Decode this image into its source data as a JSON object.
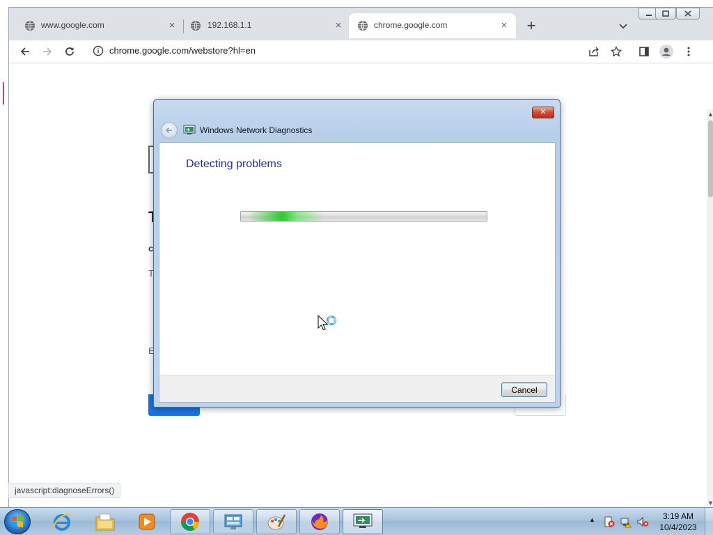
{
  "browser": {
    "tabs": [
      {
        "title": "www.google.com",
        "active": false
      },
      {
        "title": "192.168.1.1",
        "active": false
      },
      {
        "title": "chrome.google.com",
        "active": true
      }
    ],
    "tab_close_glyph": "×",
    "new_tab_glyph": "+",
    "url": "chrome.google.com/webstore?hl=en",
    "status_text": "javascript:diagnoseErrors()"
  },
  "page_fragments": {
    "heading_initial": "T",
    "sub_initial": "c",
    "text_initial": "T",
    "text2_initial": "E"
  },
  "dialog": {
    "title": "Windows Network Diagnostics",
    "heading": "Detecting problems",
    "close_glyph": "✕",
    "cancel_label": "Cancel",
    "progress": {
      "mode": "indeterminate",
      "glow_color": "#2ec82e"
    }
  },
  "taskbar": {
    "pinned": [
      "internet-explorer-icon",
      "file-explorer-icon",
      "media-player-icon",
      "chrome-icon",
      "control-panel-icon",
      "paint-icon",
      "firefox-icon",
      "network-diagnostics-icon"
    ],
    "tray_icons": [
      "action-center-icon",
      "network-error-icon",
      "volume-muted-icon"
    ],
    "clock_time": "3:19 AM",
    "clock_date": "10/4/2023"
  },
  "colors": {
    "chrome_tabstrip": "#dee1e6",
    "dialog_frame": "#bed4ec",
    "dialog_heading": "#1e3287",
    "page_primary_button": "#1a73e8"
  }
}
